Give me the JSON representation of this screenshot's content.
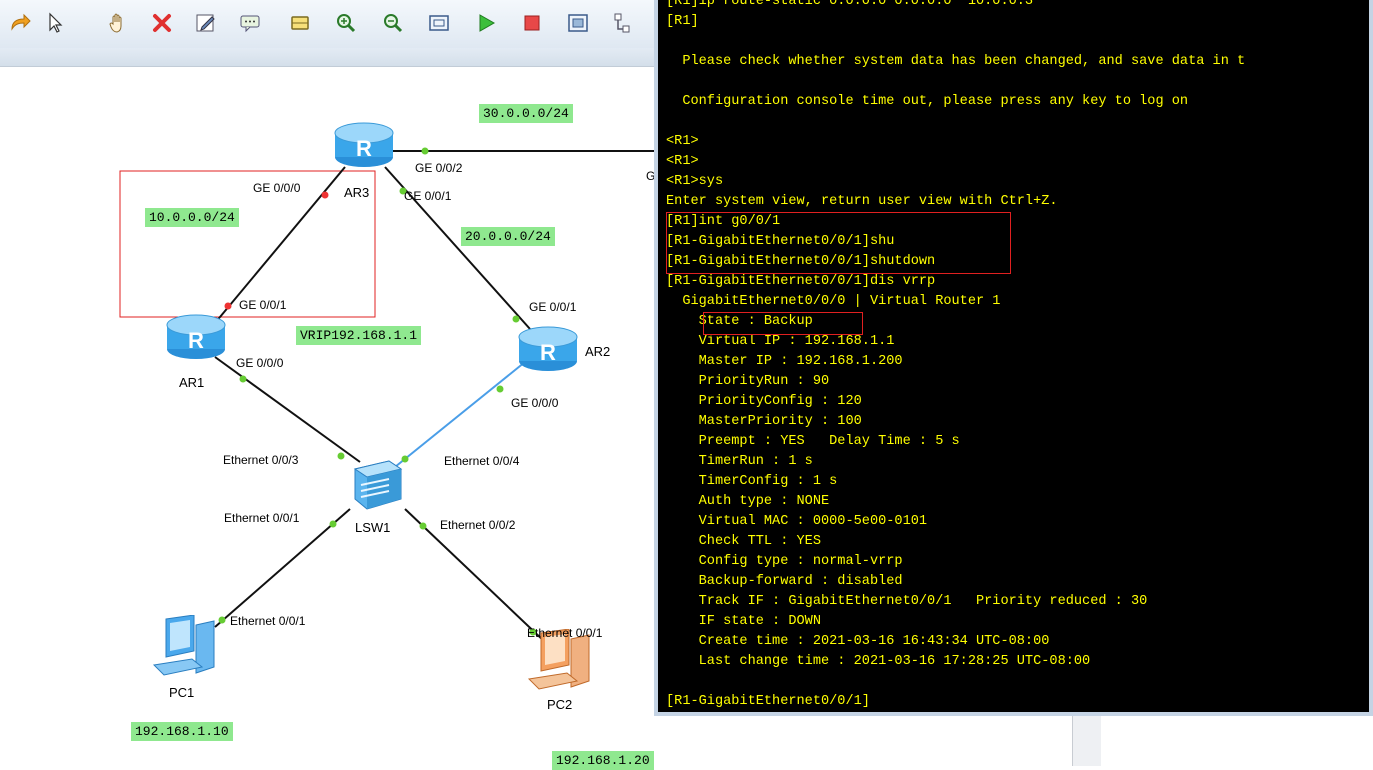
{
  "toolbar": {
    "buttons": [
      "redo-icon",
      "pointer-icon",
      "hand-icon",
      "delete-icon",
      "edit-icon",
      "chat-icon",
      "rectangle-icon",
      "zoom-in-icon",
      "zoom-out-icon",
      "fit-icon",
      "start-icon",
      "stop-icon",
      "capture-icon",
      "topology-icon"
    ]
  },
  "topology": {
    "networks": {
      "n30": "30.0.0.0/24",
      "n10": "10.0.0.0/24",
      "n20": "20.0.0.0/24",
      "vrip": "VRIP192.168.1.1",
      "pc1_ip": "192.168.1.10",
      "pc2_ip": "192.168.1.20"
    },
    "devices": {
      "ar3": "AR3",
      "ar1": "AR1",
      "ar2": "AR2",
      "lsw1": "LSW1",
      "pc1": "PC1",
      "pc2": "PC2"
    },
    "ports": {
      "ar3_g002": "GE 0/0/2",
      "ar3_g000": "GE 0/0/0",
      "ar3_g001": "GE 0/0/1",
      "ar1_g001": "GE 0/0/1",
      "ar1_g000": "GE 0/0/0",
      "ar2_g001": "GE 0/0/1",
      "ar2_g000": "GE 0/0/0",
      "sw_e003": "Ethernet 0/0/3",
      "sw_e004": "Ethernet 0/0/4",
      "sw_e001": "Ethernet 0/0/1",
      "sw_e002": "Ethernet 0/0/2",
      "pc1_e001": "Ethernet 0/0/1",
      "pc2_e001": "Ethernet 0/0/1",
      "cut_label": "G"
    },
    "colors": {
      "network_bg": "#8fe88f",
      "link_up": "#66cc33",
      "link_down": "#ee3333",
      "blue_link": "#4a9ee8"
    }
  },
  "console": {
    "lines": [
      "[R1]ip route-static 0.0.0.0 0.0.0.0  10.0.0.3",
      "[R1]",
      "",
      "  Please check whether system data has been changed, and save data in t",
      "",
      "  Configuration console time out, please press any key to log on",
      "",
      "<R1>",
      "<R1>",
      "<R1>sys",
      "Enter system view, return user view with Ctrl+Z.",
      "[R1]int g0/0/1",
      "[R1-GigabitEthernet0/0/1]shu",
      "[R1-GigabitEthernet0/0/1]shutdown",
      "[R1-GigabitEthernet0/0/1]dis vrrp",
      "  GigabitEthernet0/0/0 | Virtual Router 1",
      "    State : Backup",
      "    Virtual IP : 192.168.1.1",
      "    Master IP : 192.168.1.200",
      "    PriorityRun : 90",
      "    PriorityConfig : 120",
      "    MasterPriority : 100",
      "    Preempt : YES   Delay Time : 5 s",
      "    TimerRun : 1 s",
      "    TimerConfig : 1 s",
      "    Auth type : NONE",
      "    Virtual MAC : 0000-5e00-0101",
      "    Check TTL : YES",
      "    Config type : normal-vrrp",
      "    Backup-forward : disabled",
      "    Track IF : GigabitEthernet0/0/1   Priority reduced : 30",
      "    IF state : DOWN",
      "    Create time : 2021-03-16 16:43:34 UTC-08:00",
      "    Last change time : 2021-03-16 17:28:25 UTC-08:00",
      "",
      "[R1-GigabitEthernet0/0/1]"
    ],
    "text_color": "#ffff00",
    "highlight_color": "#e02020"
  }
}
